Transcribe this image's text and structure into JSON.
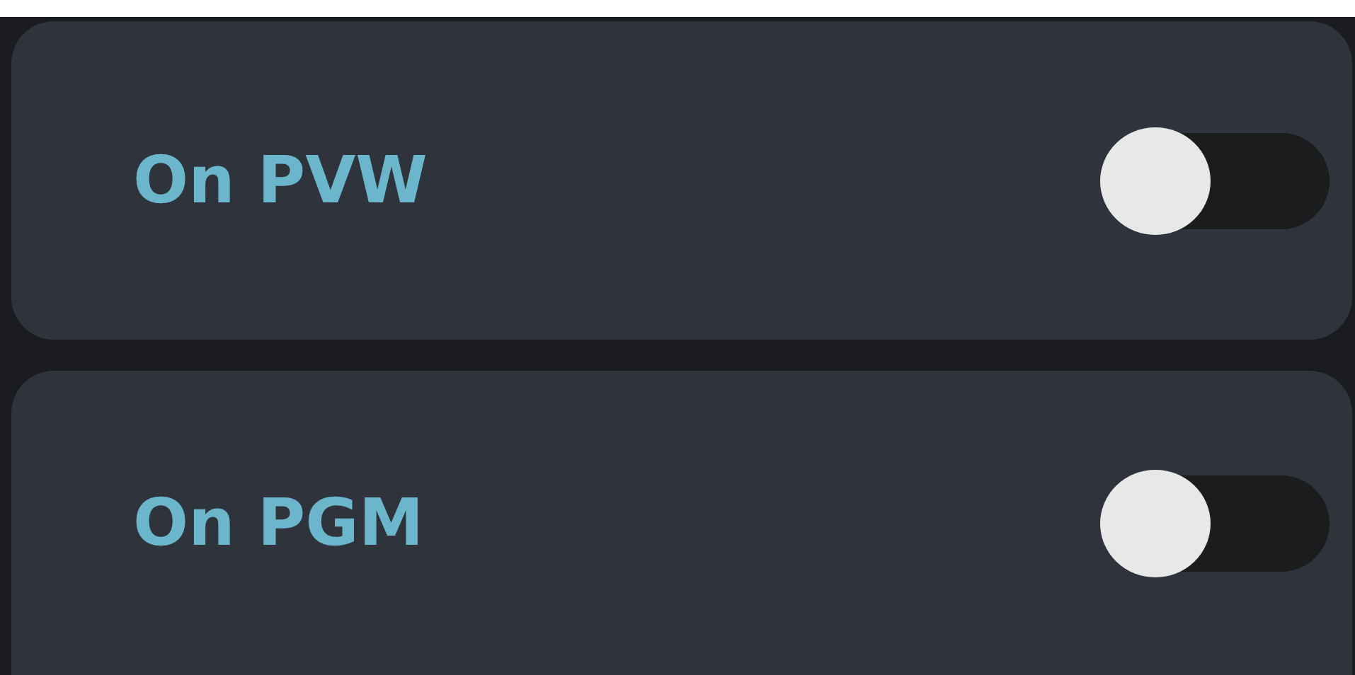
{
  "settings": [
    {
      "label": "On PVW",
      "on": false
    },
    {
      "label": "On PGM",
      "on": false
    }
  ]
}
